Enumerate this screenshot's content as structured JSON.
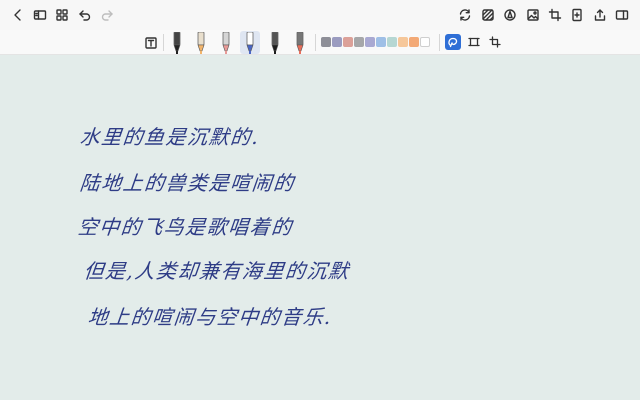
{
  "toolbar": {
    "left_icons": [
      "back-icon",
      "sidebar-icon",
      "grid-icon",
      "undo-icon",
      "redo-icon"
    ],
    "right_icons": [
      "sync-icon",
      "pattern-icon",
      "pen-circle-icon",
      "image-icon",
      "crop-icon",
      "add-page-icon",
      "share-icon",
      "layout-icon"
    ]
  },
  "pens": [
    {
      "name": "fountain-pen-icon",
      "tip": "#222222",
      "body": "#444444"
    },
    {
      "name": "highlighter-icon",
      "tip": "#f2b46b",
      "body": "#e9dfcd"
    },
    {
      "name": "eraser-icon",
      "tip": "#e89a97",
      "body": "#d5d5d5"
    },
    {
      "name": "ballpoint-pen-icon",
      "tip": "#4a66c5",
      "body": "#ffffff"
    },
    {
      "name": "marker-pen-icon",
      "tip": "#1e1e1e",
      "body": "#555555"
    },
    {
      "name": "pencil-icon",
      "tip": "#e96f5b",
      "body": "#777777"
    }
  ],
  "colors": [
    "#8e8f98",
    "#9b9cc0",
    "#dca199",
    "#a6a7a9",
    "#a9a9d2",
    "#9fbfe6",
    "#b6d7d3",
    "#f6c79a",
    "#f3a976",
    "#ffffff"
  ],
  "handwriting": {
    "lines": [
      "水里的鱼是沉默的.",
      "陆地上的兽类是喧闹的",
      "空中的飞鸟是歌唱着的",
      "但是,人类却兼有海里的沉默",
      "地上的喧闹与空中的音乐."
    ]
  }
}
